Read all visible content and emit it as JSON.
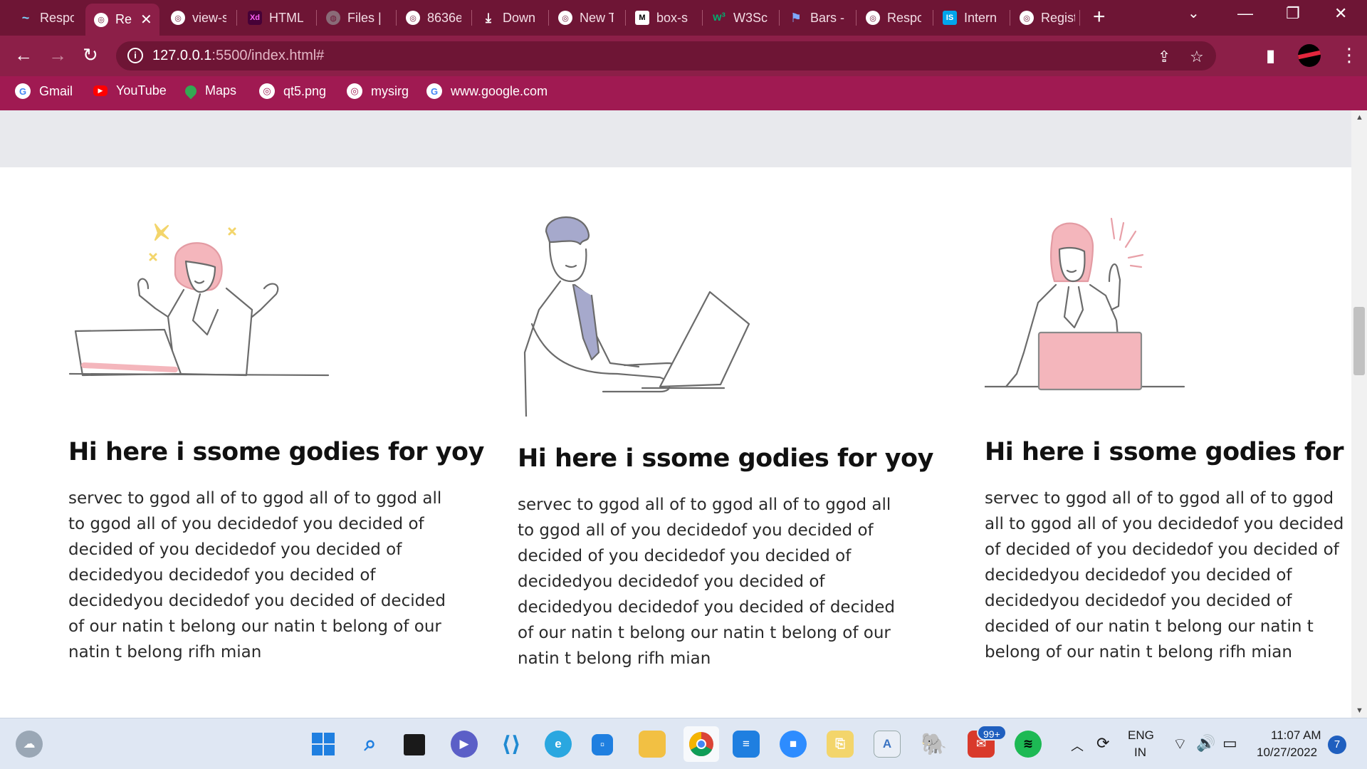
{
  "browser": {
    "tabs": [
      {
        "label": "Respo",
        "icon": "tailwind-icon",
        "active": false
      },
      {
        "label": "Re",
        "icon": "globe-icon",
        "active": true
      },
      {
        "label": "view-s",
        "icon": "globe-icon",
        "active": false
      },
      {
        "label": "HTML",
        "icon": "xd-icon",
        "active": false
      },
      {
        "label": "Files |",
        "icon": "files-icon",
        "active": false
      },
      {
        "label": "8636e",
        "icon": "globe-icon",
        "active": false
      },
      {
        "label": "Down",
        "icon": "download-icon",
        "active": false
      },
      {
        "label": "New T",
        "icon": "globe-icon",
        "active": false
      },
      {
        "label": "box-s",
        "icon": "mdn-icon",
        "active": false
      },
      {
        "label": "W3Sc",
        "icon": "w3schools-icon",
        "active": false
      },
      {
        "label": "Bars -",
        "icon": "flag-icon",
        "active": false
      },
      {
        "label": "Respo",
        "icon": "globe-icon",
        "active": false
      },
      {
        "label": "Intern",
        "icon": "internshala-icon",
        "active": false
      },
      {
        "label": "Regist",
        "icon": "globe-icon",
        "active": false
      }
    ],
    "url_host": "127.0.0.1",
    "url_rest": ":5500/index.html#",
    "bookmarks": [
      {
        "label": "Gmail",
        "icon": "google-icon"
      },
      {
        "label": "YouTube",
        "icon": "youtube-icon"
      },
      {
        "label": "Maps",
        "icon": "maps-icon"
      },
      {
        "label": "qt5.png",
        "icon": "globe-icon"
      },
      {
        "label": "mysirg",
        "icon": "globe-icon"
      },
      {
        "label": "www.google.com",
        "icon": "google-icon"
      }
    ]
  },
  "page": {
    "cards": [
      {
        "title": "Hi here i ssome godies for yoy",
        "body": "servec to ggod all of to ggod all of to ggod all to ggod all of you decidedof you decided of decided of you decidedof you decided of decidedyou decidedof you decided of decidedyou decidedof you decided of decided of our natin t belong our natin t belong of our natin t belong rifh mian",
        "illustration": "woman-laptop-celebrating"
      },
      {
        "title": "Hi here i ssome godies for yoy",
        "body": "servec to ggod all of to ggod all of to ggod all to ggod all of you decidedof you decided of decided of you decidedof you decided of decidedyou decidedof you decided of decidedyou decidedof you decided of decided of our natin t belong our natin t belong of our natin t belong rifh mian",
        "illustration": "man-typing-laptop"
      },
      {
        "title": "Hi here i ssome godies for yoy",
        "body": "servec to ggod all of to ggod all of to ggod all to ggod all of you decidedof you decided of decided of you decidedof you decided of decidedyou decidedof you decided of decidedyou decidedof you decided of decided of our natin t belong our natin t belong of our natin t belong rifh mian",
        "illustration": "woman-idea-laptop"
      }
    ]
  },
  "taskbar": {
    "mail_badge": "99+",
    "language": "ENG",
    "region": "IN",
    "time": "11:07 AM",
    "date": "10/27/2022",
    "notifications": "7"
  },
  "colors": {
    "tab_strip": "#6e1535",
    "toolbar": "#8c1f48",
    "bookmarks_bar": "#a01a52",
    "illustration_pink": "#f4b6bc",
    "line_gray": "#6b6b6b"
  }
}
